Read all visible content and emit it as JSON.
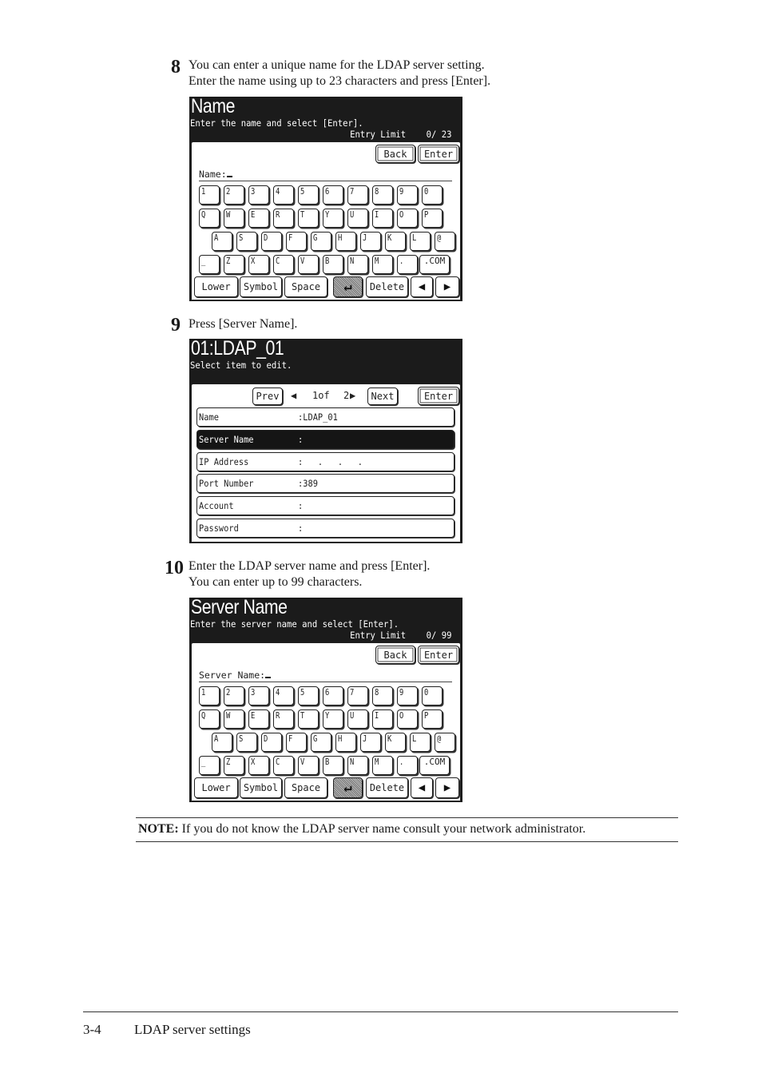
{
  "steps": [
    {
      "number": "8",
      "lines": [
        "You can enter a unique name for the LDAP server setting.",
        "Enter the name using up to 23 characters and press [Enter]."
      ],
      "screen": {
        "title": "Name",
        "subtitle": "Enter the name and select [Enter].",
        "entry_limit_label": "Entry Limit",
        "entry_limit_value": "0/ 23",
        "back_label": "Back",
        "enter_label": "Enter",
        "input_label": "Name:"
      }
    },
    {
      "number": "9",
      "lines": [
        "Press [Server Name]."
      ],
      "screen": {
        "title": "01:LDAP_01",
        "subtitle": "Select item to edit.",
        "prev_label": "Prev",
        "next_label": "Next",
        "enter_label": "Enter",
        "page_current": "1of",
        "page_total": "2",
        "items": [
          {
            "label": "Name",
            "value": ":LDAP_01",
            "selected": false
          },
          {
            "label": "Server Name",
            "value": ":",
            "selected": true
          },
          {
            "label": "IP Address",
            "value": ":   .   .   .",
            "selected": false
          },
          {
            "label": "Port Number",
            "value": ":389",
            "selected": false
          },
          {
            "label": "Account",
            "value": ":",
            "selected": false
          },
          {
            "label": "Password",
            "value": ":",
            "selected": false
          }
        ]
      }
    },
    {
      "number": "10",
      "lines": [
        "Enter the LDAP server name and press [Enter].",
        "You can enter up to 99 characters."
      ],
      "screen": {
        "title": "Server Name",
        "subtitle": "Enter the server name and select [Enter].",
        "entry_limit_label": "Entry Limit",
        "entry_limit_value": "0/ 99",
        "back_label": "Back",
        "enter_label": "Enter",
        "input_label": "Server Name:"
      }
    }
  ],
  "keyboard": {
    "rows": [
      [
        "1",
        "2",
        "3",
        "4",
        "5",
        "6",
        "7",
        "8",
        "9",
        "0"
      ],
      [
        "Q",
        "W",
        "E",
        "R",
        "T",
        "Y",
        "U",
        "I",
        "O",
        "P"
      ],
      [
        "A",
        "S",
        "D",
        "F",
        "G",
        "H",
        "J",
        "K",
        "L",
        "@"
      ],
      [
        "_",
        "Z",
        "X",
        "C",
        "V",
        "B",
        "N",
        "M",
        "."
      ]
    ],
    "dotcom": ".COM",
    "lower": "Lower",
    "symbol": "Symbol",
    "space": "Space",
    "enter_icon": "return-arrow-icon",
    "delete": "Delete",
    "left_icon": "left-arrow-icon",
    "right_icon": "right-arrow-icon"
  },
  "note": {
    "label": "NOTE:",
    "text": " If you do not know the LDAP server name consult your network administrator."
  },
  "footer": {
    "page": "3-4",
    "title": "LDAP server settings"
  }
}
